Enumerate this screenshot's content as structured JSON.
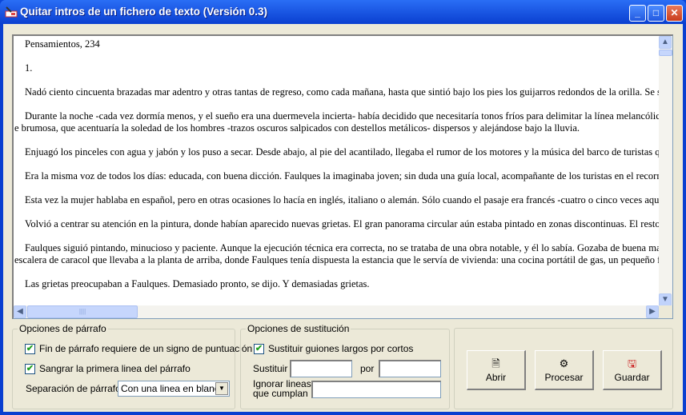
{
  "window": {
    "title": "Quitar intros de un fichero de texto (Versión 0.3)"
  },
  "text_lines": [
    {
      "text": "Pensamientos, 234",
      "cont": false
    },
    {
      "text": "",
      "cont": false
    },
    {
      "text": "1.",
      "cont": false
    },
    {
      "text": "",
      "cont": false
    },
    {
      "text": "Nadó ciento cincuenta brazadas mar adentro y otras tantas de regreso, como cada mañana, hasta que sintió bajo los pies los guijarros redondos de la orilla. Se secó uti",
      "cont": false
    },
    {
      "text": "",
      "cont": false
    },
    {
      "text": "Durante la noche -cada vez dormía menos, y el sueño era una duermevela incierta- había decidido que necesitaría tonos fríos para delimitar la línea melancólica del hor",
      "cont": false
    },
    {
      "text": "e brumosa, que acentuaría la soledad de los hombres -trazos oscuros salpicados con destellos metálicos- dispersos y alejándose bajo la lluvia.",
      "cont": true
    },
    {
      "text": "",
      "cont": false
    },
    {
      "text": "Enjuagó los pinceles con agua y jabón y los puso a secar. Desde abajo, al pie del acantilado, llegaba el rumor de los motores y la música del barco de turistas que cada",
      "cont": false
    },
    {
      "text": "",
      "cont": false
    },
    {
      "text": "Era la misma voz de todos los días: educada, con buena dicción. Faulques la imaginaba joven; sin duda una guía local, acompañante de los turistas en el recorrido de tr",
      "cont": false
    },
    {
      "text": "",
      "cont": false
    },
    {
      "text": "Esta vez la mujer hablaba en español, pero en otras ocasiones lo hacía en inglés, italiano o alemán. Sólo cuando el pasaje era francés -cuatro o cinco veces aquel veranc",
      "cont": false
    },
    {
      "text": "",
      "cont": false
    },
    {
      "text": "Volvió a centrar su atención en la pintura, donde habían aparecido nuevas grietas. El gran panorama circular aún estaba pintado en zonas discontinuas. El resto eran tr",
      "cont": false
    },
    {
      "text": "",
      "cont": false
    },
    {
      "text": "Faulques siguió pintando, minucioso y paciente. Aunque la ejecución técnica era correcta, no se trataba de una obra notable, y él lo sabía. Gozaba de buena mano para",
      "cont": false
    },
    {
      "text": "escalera de caracol que llevaba a la planta de arriba, donde Faulques tenía dispuesta la estancia que le servía de vivienda: una cocina portátil de gas, un pequeño frigorífic",
      "cont": true
    },
    {
      "text": "",
      "cont": false
    },
    {
      "text": "Las grietas preocupaban a Faulques. Demasiado pronto, se dijo. Y demasiadas grietas.",
      "cont": false
    }
  ],
  "paragraph_options": {
    "legend": "Opciones de párrafo",
    "require_punct": {
      "label": "Fin de párrafo requiere de un signo de puntuación",
      "checked": true
    },
    "indent_first": {
      "label": "Sangrar la primera linea del párrafo",
      "checked": true
    },
    "separation_label": "Separación de párrafos",
    "separation_value": "Con una linea en blanco"
  },
  "substitution_options": {
    "legend": "Opciones de sustitución",
    "replace_dashes": {
      "label": "Sustituir guiones largos por cortos",
      "checked": true
    },
    "replace_label": "Sustituir",
    "replace_value": "",
    "by_label": "por",
    "by_value": "",
    "ignore_label_1": "Ignorar lineas",
    "ignore_label_2": "que cumplan",
    "ignore_value": ""
  },
  "actions": {
    "open": "Abrir",
    "process": "Procesar",
    "save": "Guardar"
  }
}
